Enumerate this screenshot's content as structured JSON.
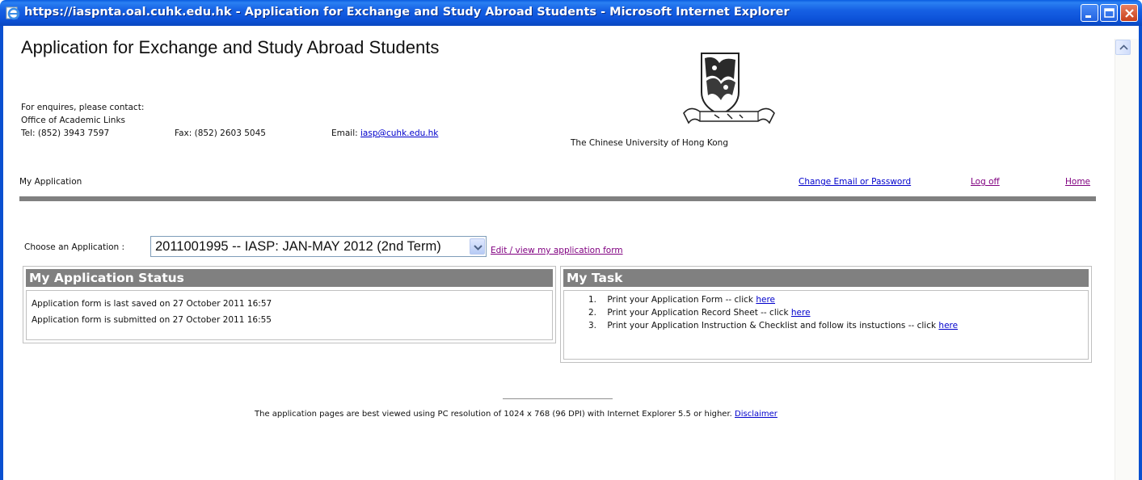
{
  "window": {
    "title": "https://iaspnta.oal.cuhk.edu.hk - Application for Exchange and Study Abroad Students - Microsoft Internet Explorer"
  },
  "header": {
    "title": "Application for Exchange and Study Abroad Students",
    "enquiries": "For enquires, please contact:",
    "office": "Office of Academic Links",
    "tel": "Tel: (852) 3943 7597",
    "fax": "Fax: (852) 2603 5045",
    "email_label": "Email:",
    "email": "iasp@cuhk.edu.hk",
    "university": "The Chinese University of Hong Kong"
  },
  "nav": {
    "section": "My Application",
    "change_email": "Change Email or Password",
    "log_off": "Log off",
    "home": "Home"
  },
  "application": {
    "choose_label": "Choose an Application :",
    "selected": "2011001995 -- IASP: JAN-MAY 2012 (2nd Term)",
    "edit_link": "Edit / view my application form"
  },
  "status_panel": {
    "title": "My Application Status",
    "lines": [
      "Application form is last saved on 27 October 2011 16:57",
      "Application form is submitted on 27 October 2011 16:55"
    ]
  },
  "task_panel": {
    "title": "My Task",
    "items": [
      {
        "num": "1.",
        "text": "Print your Application Form -- click",
        "link": "here"
      },
      {
        "num": "2.",
        "text": "Print your Application Record Sheet -- click",
        "link": "here"
      },
      {
        "num": "3.",
        "text": "Print your Application Instruction & Checklist and follow its instuctions -- click",
        "link": "here"
      }
    ]
  },
  "footer": {
    "note": "The application pages are best viewed using PC resolution of 1024 x 768 (96 DPI) with Internet Explorer 5.5 or higher.",
    "disclaimer": "Disclaimer"
  },
  "colors": {
    "titlebar": "#0c52d8",
    "panel_header": "#808080",
    "link": "#0000cc",
    "visited_link": "#800080"
  }
}
